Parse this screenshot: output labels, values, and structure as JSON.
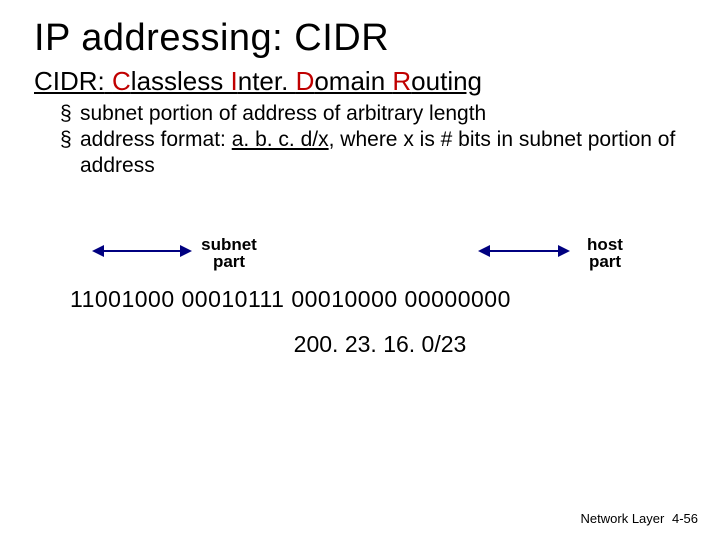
{
  "title": "IP addressing: CIDR",
  "subtitle": {
    "prefix": "CIDR:",
    "c_word": "C",
    "c_rest": "lassless ",
    "i_word": "I",
    "i_rest": "nter. ",
    "d_word": "D",
    "d_rest": "omain ",
    "r_word": "R",
    "r_rest": "outing"
  },
  "bullets": [
    {
      "text": "subnet portion of address of arbitrary length"
    },
    {
      "pre": "address format: ",
      "fmt": "a. b. c. d/x",
      "post": ", where x is # bits in subnet portion of address"
    }
  ],
  "labels": {
    "subnet_l1": "subnet",
    "subnet_l2": "part",
    "host_l1": "host",
    "host_l2": "part"
  },
  "bits": "11001000  00010111  00010000  00000000",
  "cidr_example": "200. 23. 16. 0/23",
  "footer": {
    "section": "Network Layer",
    "page": "4-56"
  }
}
